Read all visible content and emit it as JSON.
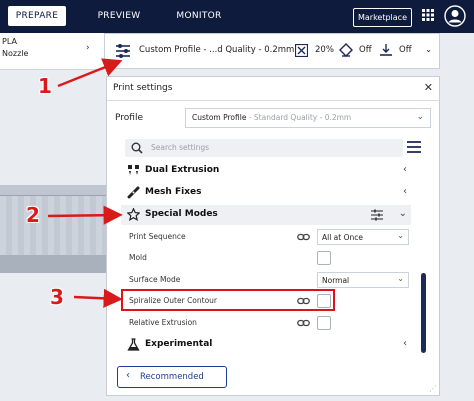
{
  "topbar": {
    "tabs": [
      {
        "label": "PREPARE",
        "active": true
      },
      {
        "label": "PREVIEW",
        "active": false
      },
      {
        "label": "MONITOR",
        "active": false
      }
    ],
    "marketplace_label": "Marketplace",
    "bg_color": "#0f1b3d"
  },
  "left_panel": {
    "material": "PLA",
    "nozzle": "Nozzle"
  },
  "profile_bar": {
    "profile_text": "Custom Profile - ...d Quality - 0.2mm",
    "infill": "20%",
    "support": "Off",
    "adhesion": "Off"
  },
  "print_settings": {
    "title": "Print settings",
    "profile_label": "Profile",
    "profile_name": "Custom Profile",
    "profile_sub": " - Standard Quality - 0.2mm",
    "search_placeholder": "Search settings",
    "sections": [
      {
        "label": "Dual Extrusion",
        "icon": "dual-extrusion-icon"
      },
      {
        "label": "Mesh Fixes",
        "icon": "mesh-fixes-icon"
      },
      {
        "label": "Special Modes",
        "icon": "star-icon"
      },
      {
        "label": "Experimental",
        "icon": "flask-icon"
      }
    ],
    "settings": [
      {
        "label": "Print Sequence",
        "value": "All at Once"
      },
      {
        "label": "Mold"
      },
      {
        "label": "Surface Mode",
        "value": "Normal"
      },
      {
        "label": "Spiralize Outer Contour"
      },
      {
        "label": "Relative Extrusion"
      }
    ],
    "recommended_label": "Recommended"
  },
  "annotations": [
    "1",
    "2",
    "3"
  ],
  "highlight_color": "#e0111b"
}
